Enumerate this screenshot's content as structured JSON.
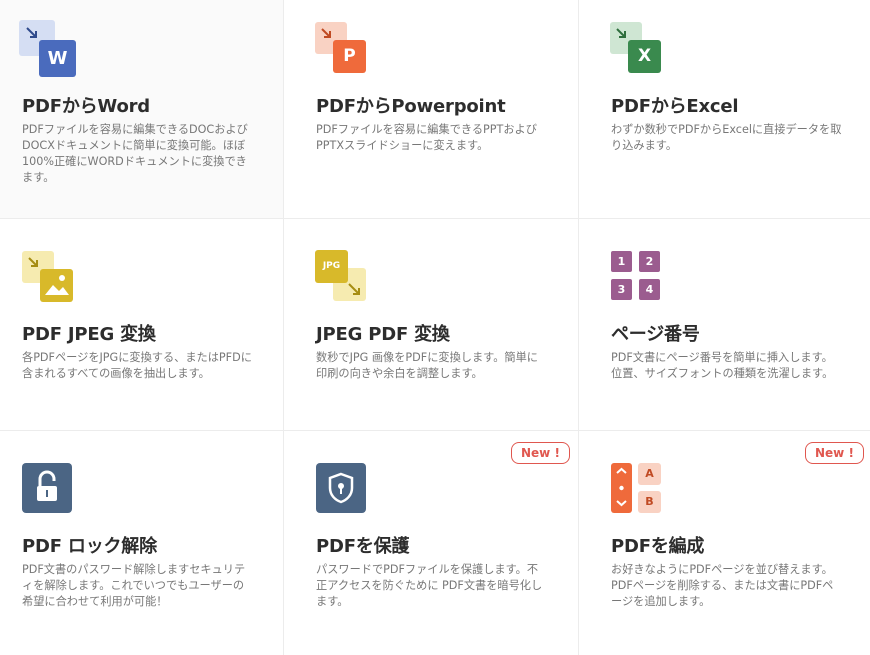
{
  "cards": [
    {
      "title": "PDFからWord",
      "desc": "PDFファイルを容易に編集できるDOCおよびDOCXドキュメントに簡単に変換可能。ほぼ100%正確にWORDドキュメントに変換できます。",
      "icon_letter": "W",
      "icon": "word-icon"
    },
    {
      "title": "PDFからPowerpoint",
      "desc": "PDFファイルを容易に編集できるPPTおよびPPTXスライドショーに変えます。",
      "icon_letter": "P",
      "icon": "powerpoint-icon"
    },
    {
      "title": "PDFからExcel",
      "desc": "わずか数秒でPDFからExcelに直接データを取り込みます。",
      "icon_letter": "X",
      "icon": "excel-icon"
    },
    {
      "title": "PDF JPEG 変換",
      "desc": "各PDFページをJPGに変換する、またはPFDに含まれるすべての画像を抽出します。",
      "icon": "image-icon"
    },
    {
      "title": "JPEG PDF 変換",
      "desc": "数秒でJPG 画像をPDFに変換します。簡単に印刷の向きや余白を調整します。",
      "icon_label": "JPG",
      "icon": "jpg-icon"
    },
    {
      "title": "ページ番号",
      "desc": "PDF文書にページ番号を簡単に挿入します。位置、サイズフォントの種類を洗濯します。",
      "numbers": [
        "1",
        "2",
        "3",
        "4"
      ],
      "icon": "page-numbers-icon"
    },
    {
      "title": "PDF ロック解除",
      "desc": "PDF文書のパスワード解除しますセキュリティを解除します。これでいつでもユーザーの希望に合わせて利用が可能！",
      "icon": "unlock-icon"
    },
    {
      "title": "PDFを保護",
      "desc": "パスワードでPDFファイルを保護します。不正アクセスを防ぐために PDF文書を暗号化します。",
      "badge": "New !",
      "icon": "shield-icon"
    },
    {
      "title": "PDFを編成",
      "desc": "お好きなようにPDFページを並び替えます。PDFページを削除する、または文書にPDFページを追加します。",
      "badge": "New !",
      "tiles": [
        "A",
        "B"
      ],
      "icon": "organize-icon"
    }
  ],
  "colors": {
    "word": "#4a6bbd",
    "powerpoint": "#ef6a3b",
    "excel": "#3a8a4e",
    "yellow": "#d8b92a",
    "purple": "#9b5c8f",
    "slate": "#4b6584",
    "badge": "#e0574f"
  }
}
